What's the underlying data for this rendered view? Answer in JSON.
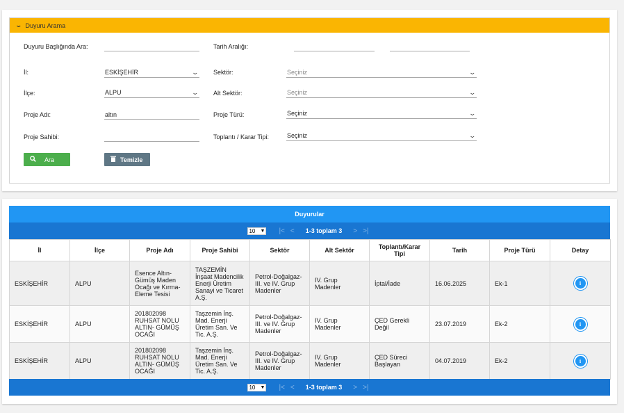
{
  "search": {
    "header_title": "Duyuru Arama",
    "labels": {
      "title_search": "Duyuru Başlığında Ara:",
      "date_range": "Tarih Aralığı:",
      "province": "İl:",
      "sector": "Sektör:",
      "district": "İlçe:",
      "sub_sector": "Alt Sektör:",
      "project_name": "Proje Adı:",
      "project_type": "Proje Türü:",
      "project_owner": "Proje Sahibi:",
      "meeting_type": "Toplantı / Karar Tipi:"
    },
    "values": {
      "title_search": "",
      "date_from": "",
      "date_to": "",
      "province": "ESKİŞEHİR",
      "district": "ALPU",
      "project_name": "altın",
      "project_owner": "",
      "sector": "Seçiniz",
      "sub_sector": "Seçiniz",
      "project_type": "Seçiniz",
      "meeting_type": "Seçiniz"
    },
    "buttons": {
      "search": "Ara",
      "clear": "Temizle"
    }
  },
  "results": {
    "title": "Duyurular",
    "pager": {
      "page_size": "10",
      "info": "1-3 toplam 3"
    },
    "columns": [
      "İl",
      "İlçe",
      "Proje Adı",
      "Proje Sahibi",
      "Sektör",
      "Alt Sektör",
      "Toplantı/Karar Tipi",
      "Tarih",
      "Proje Türü",
      "Detay"
    ],
    "rows": [
      {
        "il": "ESKİŞEHİR",
        "ilce": "ALPU",
        "proje_adi": "Esence Altın- Gümüş Maden Ocağı ve Kırma- Eleme Tesisi",
        "proje_sahibi": "TAŞZEMİN İnşaat Madencilik Enerji Üretim Sanayi ve Ticaret A.Ş.",
        "sektor": "Petrol-Doğalgaz- III. ve IV. Grup Madenler",
        "alt_sektor": "IV. Grup Madenler",
        "karar_tipi": "İptal/İade",
        "tarih": "16.06.2025",
        "proje_turu": "Ek-1"
      },
      {
        "il": "ESKİŞEHİR",
        "ilce": "ALPU",
        "proje_adi": "201802098 RUHSAT NOLU ALTIN- GÜMÜŞ OCAĞI",
        "proje_sahibi": "Taşzemin İnş. Mad. Enerji Üretim San. Ve Tic. A.Ş.",
        "sektor": "Petrol-Doğalgaz- III. ve IV. Grup Madenler",
        "alt_sektor": "IV. Grup Madenler",
        "karar_tipi": "ÇED Gerekli Değil",
        "tarih": "23.07.2019",
        "proje_turu": "Ek-2"
      },
      {
        "il": "ESKİŞEHİR",
        "ilce": "ALPU",
        "proje_adi": "201802098 RUHSAT NOLU ALTIN- GÜMÜŞ OCAĞI",
        "proje_sahibi": "Taşzemin İnş. Mad. Enerji Üretim San. Ve Tic. A.Ş.",
        "sektor": "Petrol-Doğalgaz- III. ve IV. Grup Madenler",
        "alt_sektor": "IV. Grup Madenler",
        "karar_tipi": "ÇED Süreci Başlayan",
        "tarih": "04.07.2019",
        "proje_turu": "Ek-2"
      }
    ]
  },
  "colors": {
    "header": "#fab502",
    "primary": "#2196f3",
    "pager": "#1976d2",
    "search_button": "#4cae4c",
    "clear_button": "#5f7785"
  },
  "icons": {
    "collapse": "chevron-down-icon",
    "search": "search-icon",
    "clear": "trash-icon",
    "detail": "info-icon",
    "first": "first-page-icon",
    "prev": "prev-page-icon",
    "next": "next-page-icon",
    "last": "last-page-icon"
  }
}
